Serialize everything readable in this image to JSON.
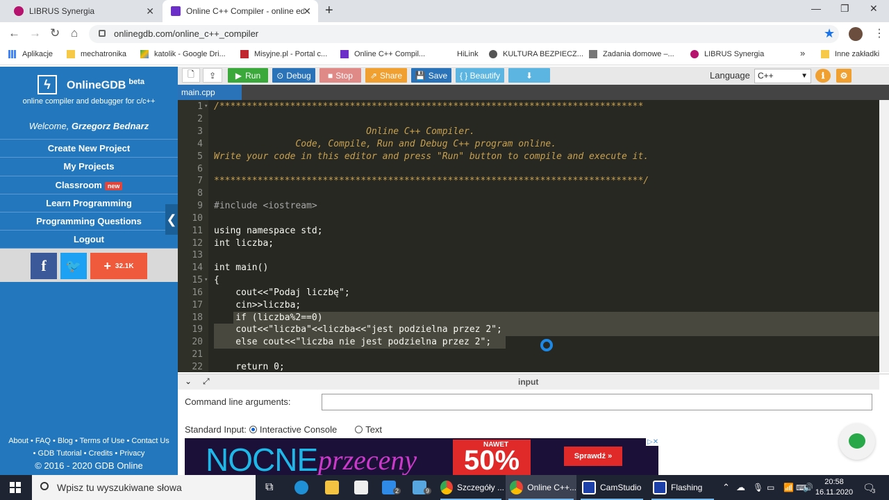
{
  "browser": {
    "tabs": [
      {
        "title": "LIBRUS Synergia",
        "icon_color": "#b5136d"
      },
      {
        "title": "Online C++ Compiler - online ed",
        "icon_color": "#6c2fc7"
      }
    ],
    "address": "onlinegdb.com/online_c++_compiler",
    "bookmarks": [
      "Aplikacje",
      "mechatronika",
      "katolik - Google Dri...",
      "Misyjne.pl - Portal c...",
      "Online C++ Compil...",
      "HiLink",
      "KULTURA BEZPIECZ...",
      "Zadania domowe –...",
      "LIBRUS Synergia",
      "Inne zakładki"
    ],
    "bookmarks_more": "»"
  },
  "sidebar": {
    "brand": "OnlineGDB",
    "brand_sup": "beta",
    "subtitle": "online compiler and debugger for c/c++",
    "welcome_prefix": "Welcome,",
    "welcome_user": "Grzegorz Bednarz",
    "menu": [
      "Create New Project",
      "My Projects",
      "Classroom",
      "Learn Programming",
      "Programming Questions",
      "Logout"
    ],
    "classroom_badge": "new",
    "share_count": "32.1K",
    "footer_line1": "About • FAQ • Blog • Terms of Use • Contact Us",
    "footer_line2": "• GDB Tutorial • Credits • Privacy",
    "copyright": "© 2016 - 2020 GDB Online"
  },
  "toolbar": {
    "run": "Run",
    "debug": "Debug",
    "stop": "Stop",
    "share": "Share",
    "save": "Save",
    "beautify": "{ } Beautify",
    "language_label": "Language",
    "language_value": "C++"
  },
  "editor": {
    "file_tab": "main.cpp",
    "lines": [
      "/******************************************************************************",
      "",
      "                            Online C++ Compiler.",
      "               Code, Compile, Run and Debug C++ program online.",
      "Write your code in this editor and press \"Run\" button to compile and execute it.",
      "",
      "*******************************************************************************/",
      "",
      "#include <iostream>",
      "",
      "using namespace std;",
      "int liczba;",
      "",
      "int main()",
      "{",
      "    cout<<\"Podaj liczbę\";",
      "    cin>>liczba;",
      "    if (liczba%2==0)",
      "    cout<<\"liczba\"<<liczba<<\"jest podzielna przez 2\";",
      "    else cout<<\"liczba nie jest podzielna przez 2\";",
      "",
      "    return 0;"
    ]
  },
  "input_panel": {
    "title": "input",
    "cla_label": "Command line arguments:",
    "stdin_label": "Standard Input:",
    "opt_console": "Interactive Console",
    "opt_text": "Text"
  },
  "ad": {
    "word1": "NOCNE",
    "word2": "przeceny",
    "nawet": "NAWET",
    "percent": "50%",
    "cta": "Sprawdź »",
    "close": "▷✕"
  },
  "taskbar": {
    "search_placeholder": "Wpisz tu wyszukiwane słowa",
    "mail_badge": "2",
    "files_badge": "9",
    "apps": [
      "Szczegóły ...",
      "Online C++...",
      "CamStudio",
      "Flashing"
    ],
    "time": "20:58",
    "date": "16.11.2020",
    "notif_count": "3"
  },
  "colors": {
    "sidebar_bg": "#2378bd",
    "editor_bg": "#272822",
    "run": "#3aa83a",
    "debug": "#2b73b8",
    "stop": "#d9534f",
    "share": "#f0a030",
    "save": "#2b73b8",
    "beautify": "#5bb5e0"
  }
}
